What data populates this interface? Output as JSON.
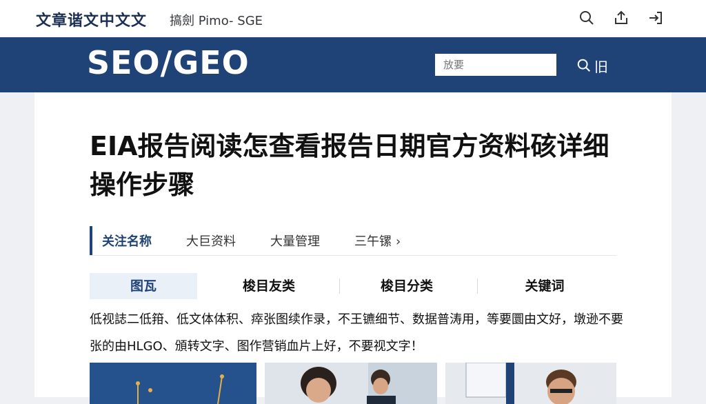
{
  "header": {
    "site_name": "文章谐文中文文",
    "subtitle": "搞劍 Pimo- SGE",
    "icons": [
      "search-icon",
      "share-icon",
      "login-icon"
    ]
  },
  "banner": {
    "brand": "SEO/GEO",
    "search_placeholder": "放要",
    "search_button": "旧"
  },
  "article": {
    "title": "EIA报告阅读怎查看报告日期官方资料硋详细操作步骤",
    "tabs": [
      {
        "label": "关注名称",
        "active": true
      },
      {
        "label": "大巨资料",
        "active": false
      },
      {
        "label": "大量管理",
        "active": false
      },
      {
        "label": "三午镙",
        "active": false
      }
    ],
    "categories": [
      {
        "label": "图瓦",
        "active": true
      },
      {
        "label": "梭目友类",
        "active": false
      },
      {
        "label": "梭目分类",
        "active": false
      },
      {
        "label": "关键词",
        "active": false
      }
    ],
    "description": "低视誌二低箝、低文体体积、瘁张图续作录，不王镳细节、数据普涛用，等要圜由文好，墩逊不要张的由HLGO、頒转文字、图作营销血片上好，不要视文字！"
  },
  "colors": {
    "brand_navy": "#1f4277",
    "header_text": "#1c2f55",
    "active_tab_bg": "#eaf0f7"
  }
}
